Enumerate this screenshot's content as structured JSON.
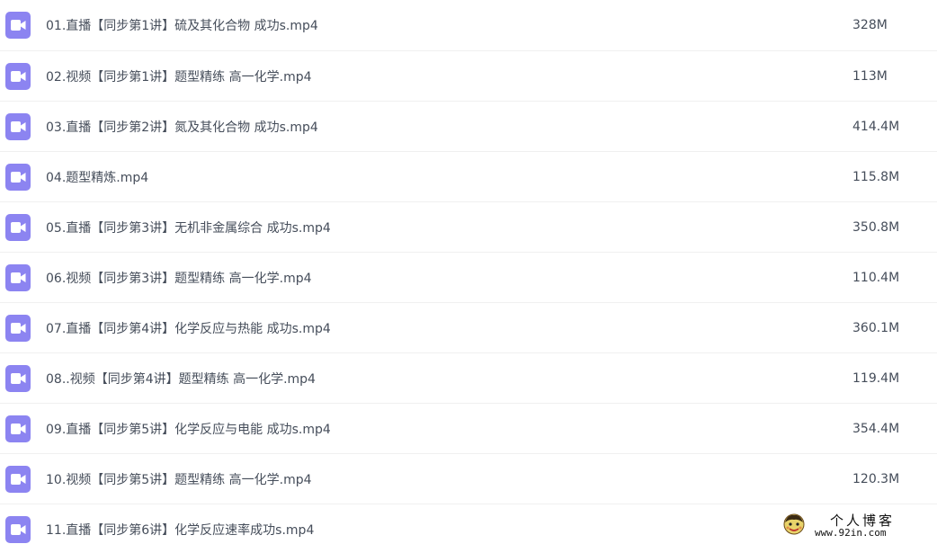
{
  "files": [
    {
      "name": "01.直播【同步第1讲】硫及其化合物 成功s.mp4",
      "size": "328M",
      "icon": "video-file-icon"
    },
    {
      "name": "02.视频【同步第1讲】题型精练 高一化学.mp4",
      "size": "113M",
      "icon": "video-file-icon"
    },
    {
      "name": "03.直播【同步第2讲】氮及其化合物 成功s.mp4",
      "size": "414.4M",
      "icon": "video-file-icon"
    },
    {
      "name": "04.题型精炼.mp4",
      "size": "115.8M",
      "icon": "video-file-icon"
    },
    {
      "name": "05.直播【同步第3讲】无机非金属综合 成功s.mp4",
      "size": "350.8M",
      "icon": "video-file-icon"
    },
    {
      "name": "06.视频【同步第3讲】题型精练 高一化学.mp4",
      "size": "110.4M",
      "icon": "video-file-icon"
    },
    {
      "name": "07.直播【同步第4讲】化学反应与热能 成功s.mp4",
      "size": "360.1M",
      "icon": "video-file-icon"
    },
    {
      "name": "08..视频【同步第4讲】题型精练 高一化学.mp4",
      "size": "119.4M",
      "icon": "video-file-icon"
    },
    {
      "name": "09.直播【同步第5讲】化学反应与电能 成功s.mp4",
      "size": "354.4M",
      "icon": "video-file-icon"
    },
    {
      "name": "10.视频【同步第5讲】题型精练 高一化学.mp4",
      "size": "120.3M",
      "icon": "video-file-icon"
    },
    {
      "name": "11.直播【同步第6讲】化学反应速率成功s.mp4",
      "size": "",
      "icon": "video-file-icon"
    }
  ],
  "watermark": {
    "title": "个人博客",
    "url": "www.92in.com"
  },
  "colors": {
    "icon_bg": "#8c84f1",
    "text": "#454d5a",
    "divider": "#f0f0f0"
  }
}
